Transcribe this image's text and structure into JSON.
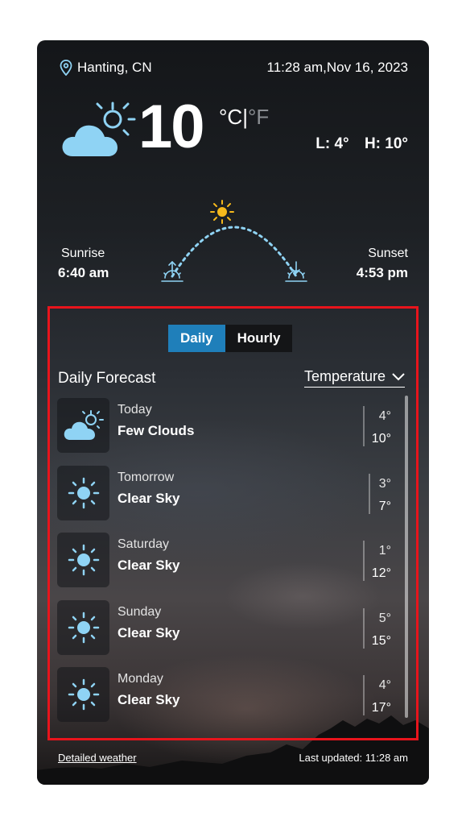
{
  "header": {
    "location": "Hanting, CN",
    "datetime": "11:28 am,Nov 16, 2023"
  },
  "current": {
    "temperature": "10",
    "unit_c": "°C",
    "unit_sep": "|",
    "unit_f": "°F",
    "low": "L: 4°",
    "high": "H: 10°",
    "icon": "partly-cloudy-icon"
  },
  "sun": {
    "sunrise_label": "Sunrise",
    "sunrise_time": "6:40 am",
    "sunset_label": "Sunset",
    "sunset_time": "4:53 pm"
  },
  "forecast": {
    "toggle": {
      "daily": "Daily",
      "hourly": "Hourly",
      "selected": "Daily"
    },
    "title": "Daily Forecast",
    "metric": "Temperature",
    "days": [
      {
        "day": "Today",
        "desc": "Few Clouds",
        "low": "4°",
        "high": "10°",
        "icon": "partly-cloudy-icon"
      },
      {
        "day": "Tomorrow",
        "desc": "Clear Sky",
        "low": "3°",
        "high": "7°",
        "icon": "sun-icon"
      },
      {
        "day": "Saturday",
        "desc": "Clear Sky",
        "low": "1°",
        "high": "12°",
        "icon": "sun-icon"
      },
      {
        "day": "Sunday",
        "desc": "Clear Sky",
        "low": "5°",
        "high": "15°",
        "icon": "sun-icon"
      },
      {
        "day": "Monday",
        "desc": "Clear Sky",
        "low": "4°",
        "high": "17°",
        "icon": "sun-icon"
      }
    ]
  },
  "footer": {
    "detailed": "Detailed weather",
    "updated": "Last updated: 11:28 am"
  },
  "colors": {
    "accent": "#1f7fba",
    "highlight_border": "#e8141c",
    "cloud": "#8fd3f4",
    "sun": "#f6b91c"
  }
}
